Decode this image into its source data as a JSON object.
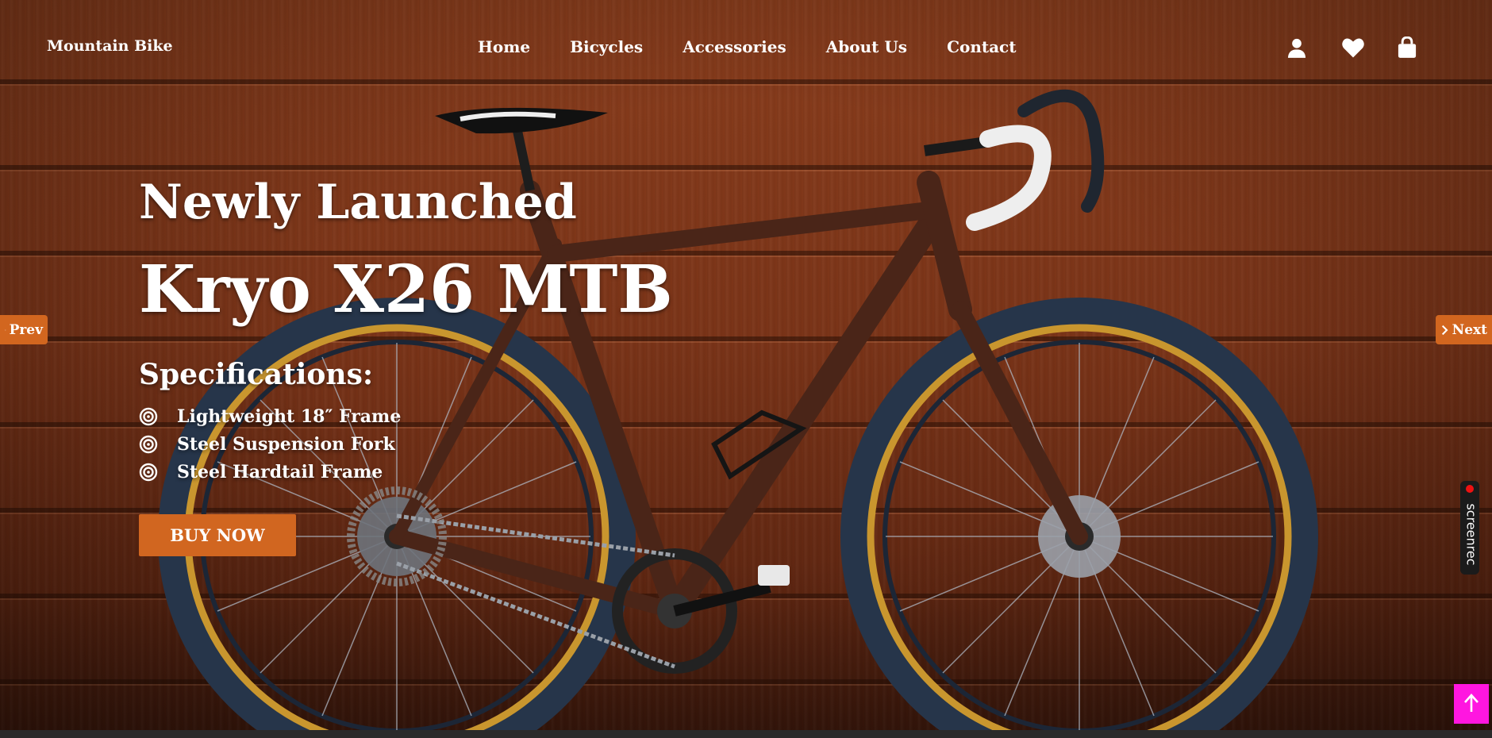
{
  "nav": {
    "brand": "Mountain Bike",
    "links": [
      "Home",
      "Bicycles",
      "Accessories",
      "About Us",
      "Contact"
    ],
    "icons": [
      "user-icon",
      "heart-icon",
      "shopping-bag-icon"
    ]
  },
  "hero": {
    "tagline": "Newly Launched",
    "model": "Kryo X26 MTB",
    "spec_title": "Specifications:",
    "specs": [
      "Lightweight 18″ Frame",
      "Steel Suspension Fork",
      "Steel Hardtail Frame"
    ],
    "buy_label": "BUY NOW"
  },
  "slider": {
    "prev_label": "Prev",
    "next_label": "Next"
  },
  "widgets": {
    "screenrec_label": "screenrec"
  },
  "colors": {
    "accent": "#d2661f",
    "scroll_top": "#ff16e0",
    "wood": "#7b3418"
  }
}
